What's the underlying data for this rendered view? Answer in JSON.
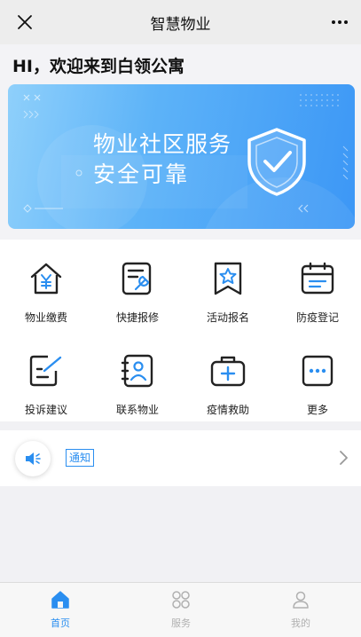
{
  "header": {
    "title": "智慧物业"
  },
  "greeting": "HI，欢迎来到白领公寓",
  "banner": {
    "line1": "物业社区服务",
    "line2": "安全可靠"
  },
  "services": [
    {
      "label": "物业缴费",
      "icon": "house-yen-icon"
    },
    {
      "label": "快捷报修",
      "icon": "wrench-doc-icon"
    },
    {
      "label": "活动报名",
      "icon": "star-bookmark-icon"
    },
    {
      "label": "防疫登记",
      "icon": "calendar-icon"
    },
    {
      "label": "投诉建议",
      "icon": "pencil-note-icon"
    },
    {
      "label": "联系物业",
      "icon": "contacts-book-icon"
    },
    {
      "label": "疫情救助",
      "icon": "medical-kit-icon"
    },
    {
      "label": "更多",
      "icon": "more-dots-icon"
    }
  ],
  "notice": {
    "tag": "通知"
  },
  "tabs": [
    {
      "label": "首页",
      "icon": "home-icon",
      "active": true
    },
    {
      "label": "服务",
      "icon": "grid-clover-icon",
      "active": false
    },
    {
      "label": "我的",
      "icon": "person-icon",
      "active": false
    }
  ],
  "colors": {
    "accent": "#2a8ef0",
    "banner_start": "#8fd0fb",
    "banner_end": "#3c97f6",
    "inactive": "#b0b0b0"
  }
}
